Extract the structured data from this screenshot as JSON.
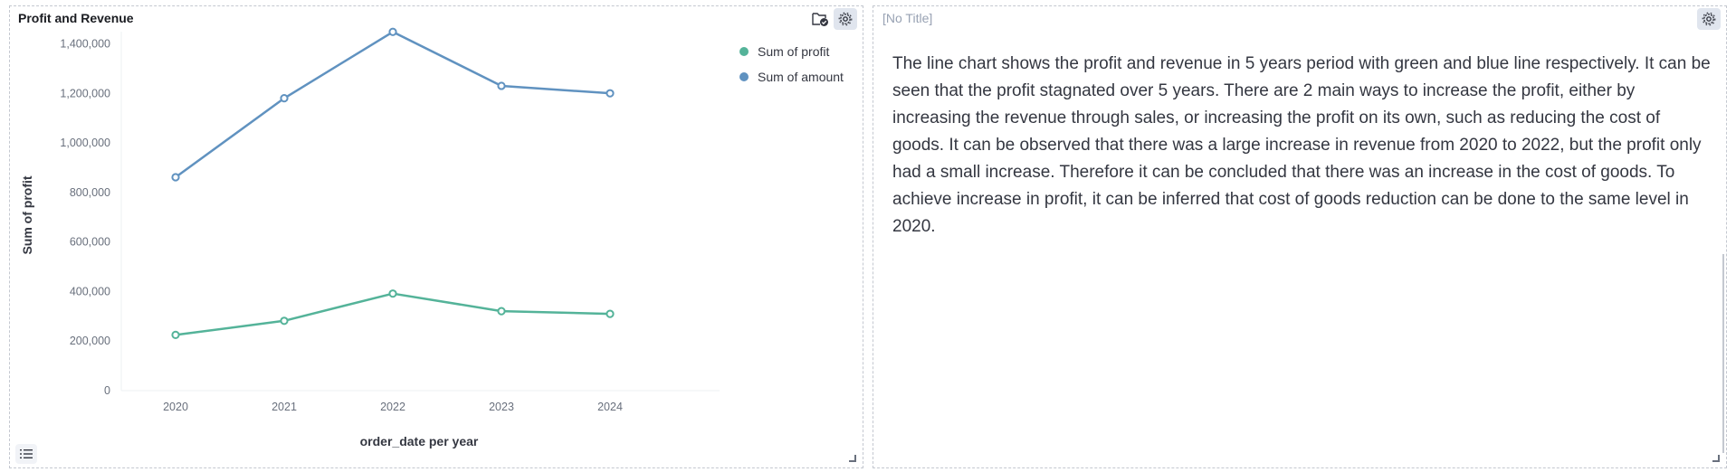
{
  "left_panel": {
    "title": "Profit and Revenue"
  },
  "right_panel": {
    "title": "[No Title]",
    "body_text": "The line chart shows the profit and revenue in 5 years period with green and blue line respectively. It can be seen that the profit stagnated over 5 years. There are 2 main ways to increase the profit, either by increasing the revenue through sales, or increasing the profit on its own, such as reducing the cost of goods. It can be observed that there was a large increase in revenue from 2020 to 2022, but the profit only had a small increase. Therefore it can be concluded that there was an increase in the cost of goods. To achieve increase in profit, it can be inferred that cost of goods reduction can be done to the same level in 2020."
  },
  "icons": {
    "folder_check": "folder-check-icon",
    "settings": "gear-icon",
    "legend_toggle": "list-icon",
    "resize": "resize-handle-icon"
  },
  "colors": {
    "profit": "#54b399",
    "amount": "#6092c0"
  },
  "chart_data": {
    "type": "line",
    "title": "Profit and Revenue",
    "xlabel": "order_date per year",
    "ylabel": "Sum of profit",
    "categories": [
      "2020",
      "2021",
      "2022",
      "2023",
      "2024"
    ],
    "ylim": [
      0,
      1450000
    ],
    "yticks": [
      0,
      200000,
      400000,
      600000,
      800000,
      1000000,
      1200000,
      1400000
    ],
    "ytick_labels": [
      "0",
      "200,000",
      "400,000",
      "600,000",
      "800,000",
      "1,000,000",
      "1,200,000",
      "1,400,000"
    ],
    "legend_position": "top-right",
    "grid": false,
    "series": [
      {
        "name": "Sum of profit",
        "color": "#54b399",
        "values": [
          225000,
          282000,
          392000,
          321000,
          310000
        ]
      },
      {
        "name": "Sum of amount",
        "color": "#6092c0",
        "values": [
          862000,
          1181000,
          1449000,
          1231000,
          1201000
        ]
      }
    ]
  }
}
